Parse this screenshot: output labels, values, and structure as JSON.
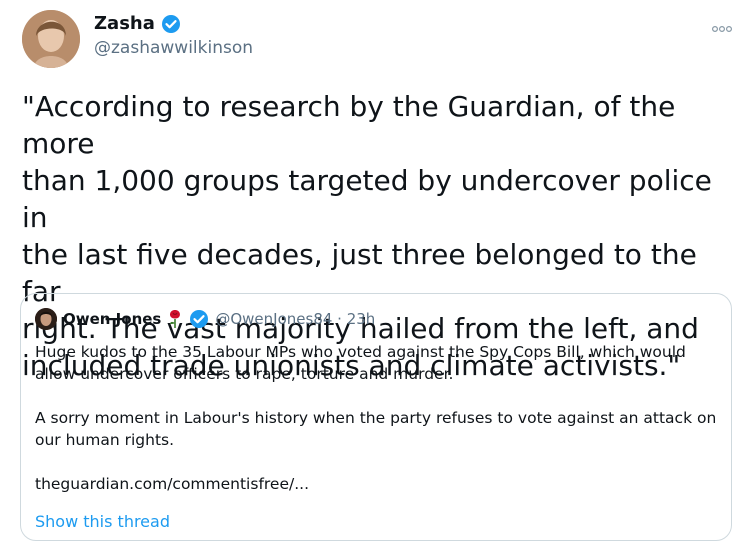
{
  "tweet": {
    "author_name": "Zasha",
    "author_handle": "@zashawwilkinson",
    "text": "\"According to research by the Guardian, of the more\nthan 1,000 groups targeted by undercover police in\nthe last five decades, just three belonged to the far\nright. The vast majority hailed from the left, and\nincluded trade unionists and climate activists.\"",
    "more_icon": "more-dots-icon",
    "verified_icon": "verified-badge-icon"
  },
  "quote": {
    "author_name": "Owen Jones",
    "rose_icon": "red-rose-icon",
    "author_handle_time": "@OwenJones84 · 23h",
    "paragraph_1": "Huge kudos to the 35 Labour MPs who voted against the Spy Cops Bill, which would allow undercover officers to rape, torture and murder.",
    "paragraph_2": "A sorry moment in Labour's history when the party refuses to vote against an attack on our human rights.",
    "link": "theguardian.com/commentisfree/...",
    "show_thread": "Show this thread"
  },
  "colors": {
    "link_blue": "#1d9bf0",
    "verified_blue": "#1d9bf0",
    "secondary_text": "#5b7083",
    "border": "#cfd9de"
  }
}
